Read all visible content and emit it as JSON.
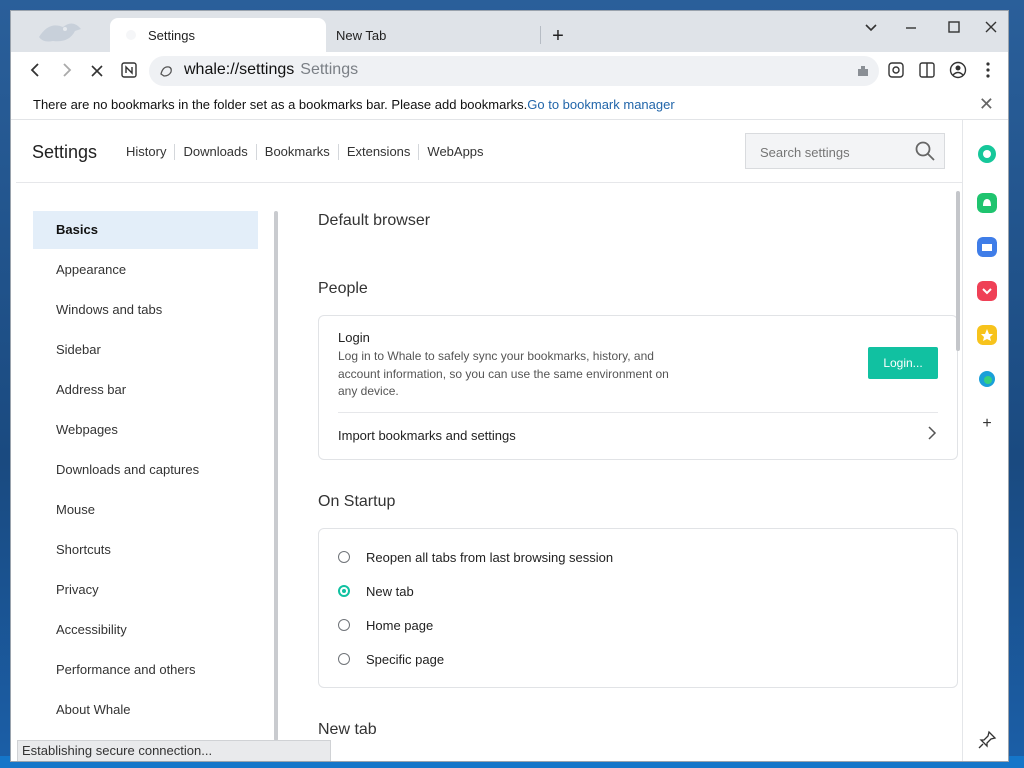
{
  "tabs": [
    {
      "label": "Settings",
      "active": true
    },
    {
      "label": "New Tab",
      "active": false
    }
  ],
  "window_controls": [
    "chevron-down-icon",
    "minimize-icon",
    "maximize-icon",
    "close-icon"
  ],
  "toolbar": {
    "url": "whale://settings",
    "page_label": "Settings"
  },
  "bookmark_bar": {
    "message": "There are no bookmarks in the folder set as a bookmarks bar. Please add bookmarks.",
    "link": "Go to bookmark manager"
  },
  "header": {
    "title": "Settings",
    "nav": [
      "History",
      "Downloads",
      "Bookmarks",
      "Extensions",
      "WebApps"
    ],
    "search_placeholder": "Search settings"
  },
  "sidebar": {
    "items": [
      {
        "label": "Basics",
        "active": true
      },
      {
        "label": "Appearance"
      },
      {
        "label": "Windows and tabs"
      },
      {
        "label": "Sidebar"
      },
      {
        "label": "Address bar"
      },
      {
        "label": "Webpages"
      },
      {
        "label": "Downloads and captures"
      },
      {
        "label": "Mouse"
      },
      {
        "label": "Shortcuts"
      },
      {
        "label": "Privacy"
      },
      {
        "label": "Accessibility"
      },
      {
        "label": "Performance and others"
      },
      {
        "label": "About Whale"
      }
    ]
  },
  "sections": {
    "default_browser": "Default browser",
    "people": {
      "title": "People",
      "login_title": "Login",
      "login_desc": "Log in to Whale to safely sync your bookmarks, history, and account information, so you can use the same environment on any device.",
      "login_button": "Login...",
      "import_label": "Import bookmarks and settings"
    },
    "startup": {
      "title": "On Startup",
      "options": [
        {
          "label": "Reopen all tabs from last browsing session",
          "checked": false
        },
        {
          "label": "New tab",
          "checked": true
        },
        {
          "label": "Home page",
          "checked": false
        },
        {
          "label": "Specific page",
          "checked": false
        }
      ]
    },
    "new_tab": "New tab"
  },
  "status": "Establishing secure connection...",
  "colors": {
    "accent": "#11c1a1",
    "sidebar_active": "#e3eef9",
    "link": "#2266aa"
  }
}
